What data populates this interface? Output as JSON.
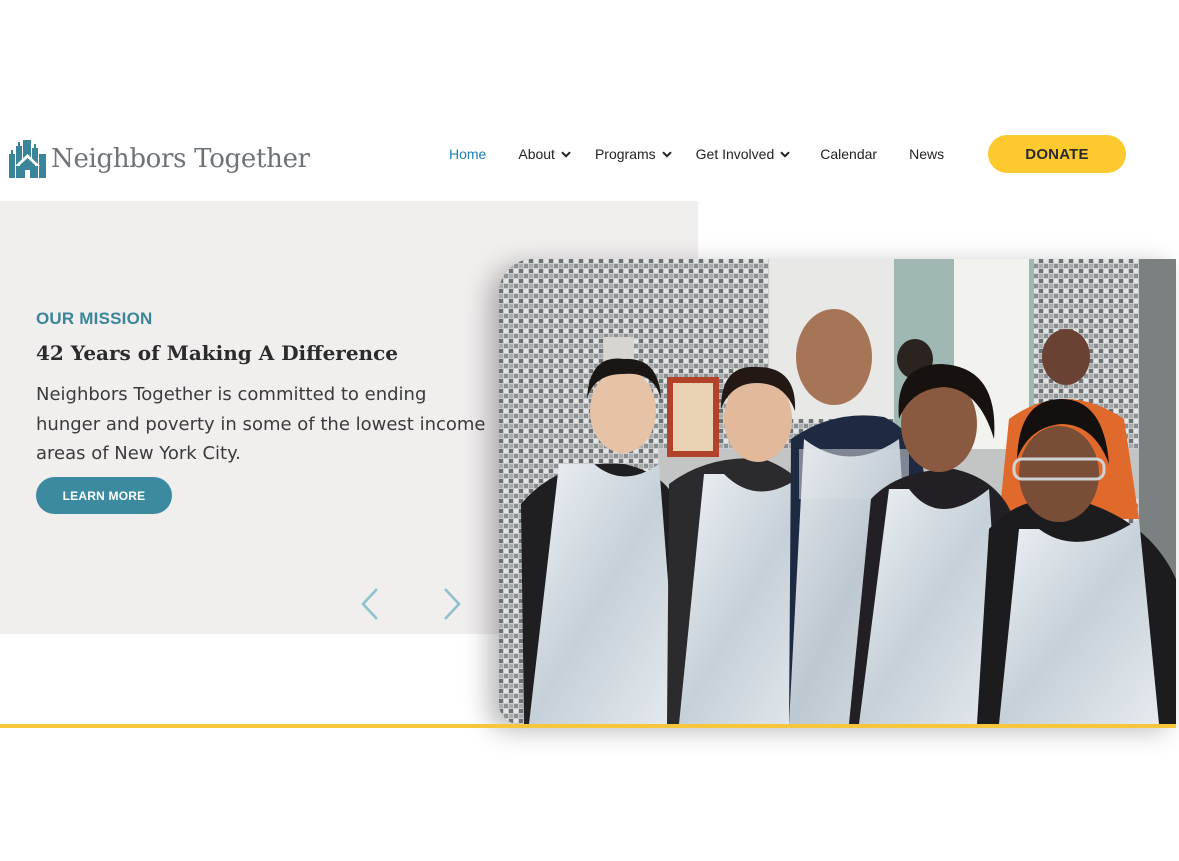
{
  "header": {
    "logo_text": "Neighbors Together",
    "logo_icon": "city-skyline-icon",
    "nav": [
      {
        "label": "Home",
        "active": true,
        "has_dropdown": false
      },
      {
        "label": "About",
        "active": false,
        "has_dropdown": true
      },
      {
        "label": "Programs",
        "active": false,
        "has_dropdown": true
      },
      {
        "label": "Get Involved",
        "active": false,
        "has_dropdown": true
      },
      {
        "label": "Calendar",
        "active": false,
        "has_dropdown": false
      },
      {
        "label": "News",
        "active": false,
        "has_dropdown": false
      }
    ],
    "donate_label": "DONATE"
  },
  "hero": {
    "eyebrow": "OUR MISSION",
    "headline": "42 Years of Making A Difference",
    "description": "Neighbors Together is committed to ending hunger and poverty in some of the lowest income areas of New York City.",
    "cta_label": "LEARN MORE",
    "prev_icon": "chevron-left-icon",
    "next_icon": "chevron-right-icon",
    "photo_subject": "volunteers-group-photo"
  },
  "colors": {
    "accent_teal": "#3b8aa0",
    "nav_active": "#1d7fb3",
    "donate_yellow": "#fcc92f",
    "panel_bg": "#f1eeee",
    "rule_yellow": "#f7c63a"
  }
}
